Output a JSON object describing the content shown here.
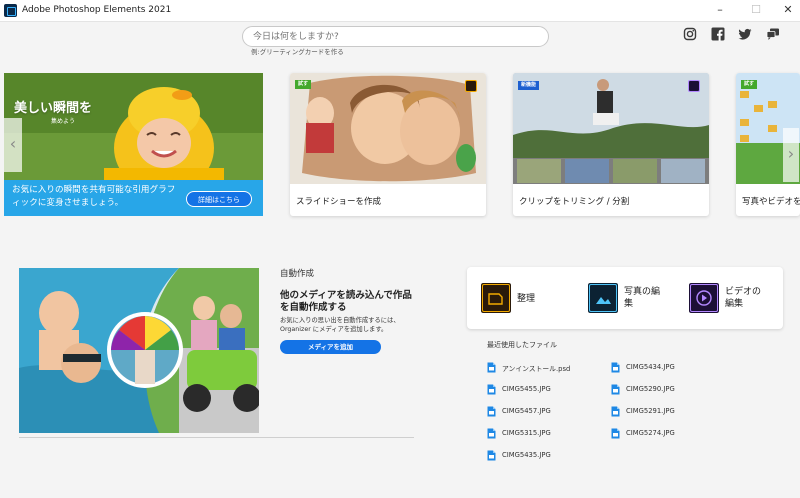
{
  "window": {
    "title": "Adobe Photoshop Elements 2021",
    "minimize": "–",
    "maximize": "☐",
    "close": "✕"
  },
  "search": {
    "placeholder": "今日は何をしますか?",
    "hint": "例:グリーティングカードを作る"
  },
  "social": [
    "instagram-icon",
    "facebook-icon",
    "twitter-icon",
    "chat-icon"
  ],
  "carousel": {
    "prev": "‹",
    "next": "›",
    "hero": {
      "title": "美しい瞬間を",
      "subtitle": "集めよう",
      "caption": "お気に入りの瞬間を共有可能な引用グラフィックに変身させましょう。",
      "button": "詳細はこちら"
    },
    "cards": [
      {
        "badge": "試す",
        "label": "スライドショーを作成"
      },
      {
        "badge": "新機能",
        "label": "クリップをトリミング / 分割"
      },
      {
        "badge": "試す",
        "label": "写真やビデオを"
      }
    ]
  },
  "auto": {
    "heading": "自動作成",
    "title": "他のメディアを読み込んで作品を自動作成する",
    "description": "お気に入りの思い出を自動作成するには、Organizer にメディアを追加します。",
    "button": "メディアを追加"
  },
  "launch": {
    "items": [
      {
        "label": "整理",
        "icon": "organizer-icon",
        "color": "#2a1a0a",
        "accent": "#f2a900"
      },
      {
        "label": "写真の編\n集",
        "icon": "photo-editor-icon",
        "color": "#0c2233",
        "accent": "#4fc3f7"
      },
      {
        "label": "ビデオの\n編集",
        "icon": "premiere-elements-icon",
        "color": "#1c0f36",
        "accent": "#b388ff"
      }
    ]
  },
  "recent": {
    "heading": "最近使用したファイル",
    "files": [
      "アンインストール.psd",
      "CIMG5434.JPG",
      "CIMG5455.JPG",
      "CIMG5290.JPG",
      "CIMG5457.JPG",
      "CIMG5291.JPG",
      "CIMG5315.JPG",
      "CIMG5274.JPG",
      "CIMG5435.JPG"
    ]
  }
}
